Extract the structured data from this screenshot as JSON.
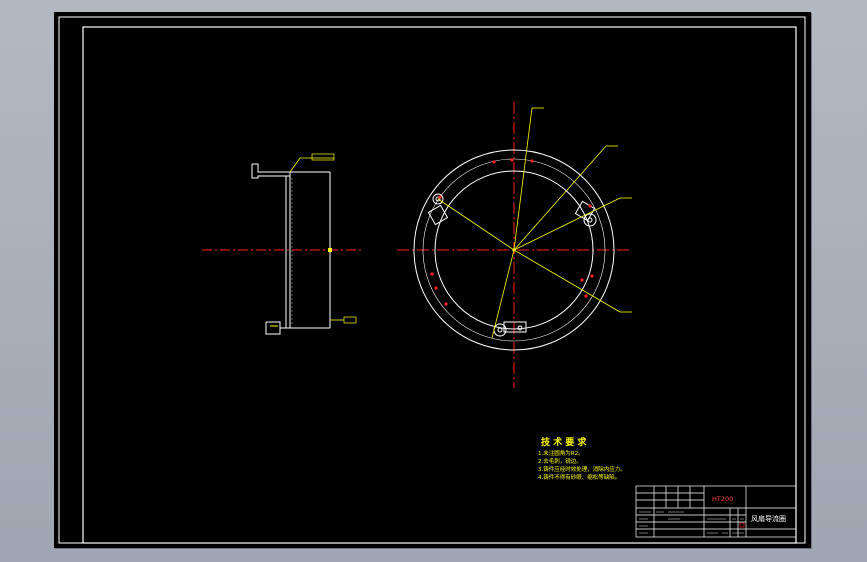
{
  "colors": {
    "background": "#a9b0ba",
    "sheet": "#000000",
    "frame": "#ffffff",
    "geometry": "#ffffff",
    "centerline": "#ff2020",
    "leader": "#ffff00",
    "notes": "#ffff00",
    "title_block_text": "#ff4040"
  },
  "notes": {
    "title": "技 术 要 求",
    "items": [
      "1.未注圆角为R2。",
      "2.去毛刺，锐边。",
      "3.铸件应经时效处理，消除内应力。",
      "4.铸件不得有砂眼、缩松等缺陷。"
    ]
  },
  "title_block": {
    "material": "HT200",
    "part_name": "风扇导流圈"
  }
}
